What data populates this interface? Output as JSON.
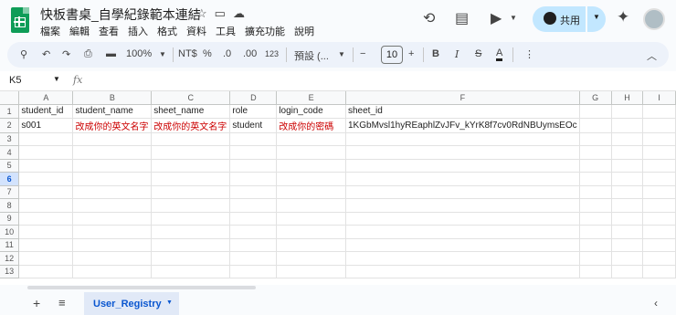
{
  "app": {
    "title": "快板書桌_自學紀錄範本連結",
    "menu": [
      "檔案",
      "編輯",
      "查看",
      "插入",
      "格式",
      "資料",
      "工具",
      "擴充功能",
      "說明"
    ],
    "share_label": "共用",
    "brand_color": "#0f9d58",
    "accent_color": "#c2e7ff"
  },
  "toolbar": {
    "zoom": "100%",
    "currency": "NT$",
    "percent": "%",
    "dec_decrease": ".0",
    "dec_increase": ".00",
    "number_format": "123",
    "font": "預設 (...",
    "font_size": "10",
    "minus": "−",
    "plus": "+",
    "bold": "B",
    "italic": "I",
    "strike": "S",
    "text_color": "A"
  },
  "formula_bar": {
    "cell_ref": "K5",
    "fx": "fx",
    "content": ""
  },
  "columns": [
    "A",
    "B",
    "C",
    "D",
    "E",
    "F",
    "G",
    "H",
    "I"
  ],
  "rows": [
    "1",
    "2",
    "3",
    "4",
    "5",
    "6",
    "7",
    "8",
    "9",
    "10",
    "11",
    "12",
    "13"
  ],
  "cells": [
    [
      "student_id",
      "student_name",
      "sheet_name",
      "role",
      "login_code",
      "sheet_id",
      "",
      "",
      ""
    ],
    [
      "s001",
      "改成你的英文名字",
      "改成你的英文名字",
      "student",
      "改成你的密碼",
      "1KGbMvsl1hyREaphlZvJFv_kYrK8f7cv0RdNBUymsEOc",
      "",
      "",
      ""
    ]
  ],
  "highlight_color": "#cc0000",
  "selected_row": "6",
  "sheet_tab": "User_Registry"
}
